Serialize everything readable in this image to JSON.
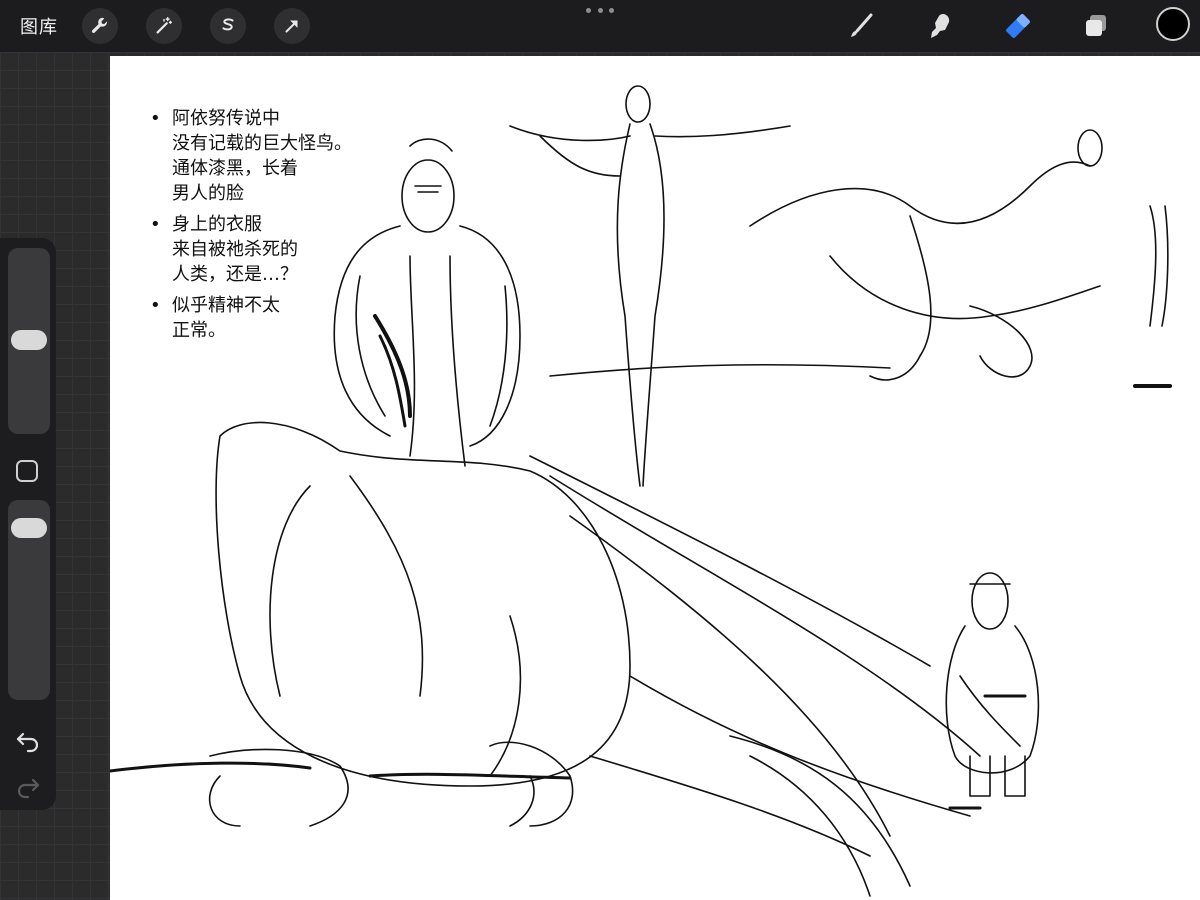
{
  "topbar": {
    "gallery_label": "图库",
    "tools_left": [
      "wrench-icon",
      "magic-wand-icon",
      "selection-icon",
      "transform-arrow-icon"
    ],
    "tools_right": [
      "brush-icon",
      "smudge-icon",
      "eraser-icon",
      "layers-icon"
    ],
    "active_tool": "eraser",
    "active_color": "#000000",
    "accent_color": "#2f7cf6"
  },
  "sidebar": {
    "controls": [
      "brush-size-slider",
      "modify-button",
      "opacity-slider",
      "undo-icon",
      "redo-icon"
    ]
  },
  "canvas": {
    "notes": [
      "阿依努传说中\n没有记载的巨大怪鸟。\n通体漆黑，长着\n男人的脸",
      "身上的衣服\n来自被祂杀死的\n人类，还是…？",
      "似乎精神不太\n正常。"
    ]
  }
}
